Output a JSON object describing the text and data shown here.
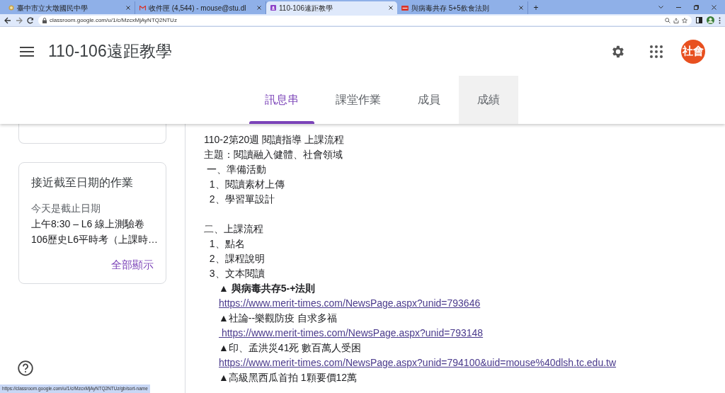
{
  "browser": {
    "tabs": [
      {
        "title": "臺中市立大墩國民中學",
        "selected": false
      },
      {
        "title": "收件匣 (4,544) - mouse@stu.dl",
        "selected": false
      },
      {
        "title": "110-106遠距教學",
        "selected": true
      },
      {
        "title": "與病毒共存 5+5飲食法則",
        "selected": false
      }
    ],
    "new_tab": "+",
    "url": "classroom.google.com/u/1/c/MzcxMjAyNTQ2NTUz"
  },
  "app": {
    "title": "110-106遠距教學",
    "avatar": "社會",
    "nav": [
      {
        "label": "訊息串",
        "selected": true,
        "hovered": false
      },
      {
        "label": "課堂作業",
        "selected": false,
        "hovered": false
      },
      {
        "label": "成員",
        "selected": false,
        "hovered": false
      },
      {
        "label": "成績",
        "selected": false,
        "hovered": true
      }
    ]
  },
  "upcoming": {
    "title": "接近截至日期的作業",
    "due_label": "今天是截止日期",
    "items": [
      "上午8:30 – L6 線上測驗卷",
      "106歷史L6平時考（上課時…"
    ],
    "view_all": "全部顯示"
  },
  "post": {
    "lines": [
      {
        "kind": "text",
        "indented": false,
        "text": "110-2第20週 閱讀指導 上課流程"
      },
      {
        "kind": "text",
        "indented": false,
        "text": "主題：閱讀融入健體、社會領域"
      },
      {
        "kind": "text",
        "indented": false,
        "text": " 一、準備活動"
      },
      {
        "kind": "text",
        "indented": false,
        "text": "  1、閱讀素材上傳"
      },
      {
        "kind": "text",
        "indented": false,
        "text": "  2、學習單設計"
      },
      {
        "kind": "blank"
      },
      {
        "kind": "text",
        "indented": false,
        "text": "二、上課流程"
      },
      {
        "kind": "text",
        "indented": false,
        "text": "  1、點名"
      },
      {
        "kind": "text",
        "indented": false,
        "text": "  2、課程說明"
      },
      {
        "kind": "text",
        "indented": false,
        "text": "  3、文本閱讀"
      },
      {
        "kind": "bold",
        "indented": true,
        "text": "▲ 與病毒共存5-+法則"
      },
      {
        "kind": "link",
        "indented": true,
        "text": "https://www.merit-times.com/NewsPage.aspx?unid=793646"
      },
      {
        "kind": "text",
        "indented": true,
        "text": "▲社論--樂觀防疫 自求多福"
      },
      {
        "kind": "link",
        "indented": true,
        "text": " https://www.merit-times.com/NewsPage.aspx?unid=793148"
      },
      {
        "kind": "text",
        "indented": true,
        "text": "▲印、孟洪災41死 數百萬人受困"
      },
      {
        "kind": "link",
        "indented": true,
        "text": "https://www.merit-times.com/NewsPage.aspx?unid=794100&uid=mouse%40dlsh.tc.edu.tw"
      },
      {
        "kind": "text",
        "indented": true,
        "text": "▲高級黑西瓜首拍 1顆要價12萬"
      }
    ]
  },
  "status_bar": "https://classroom.google.com/u/1/c/MzcxMjAyNTQ2NTUz/gb/sort-name"
}
